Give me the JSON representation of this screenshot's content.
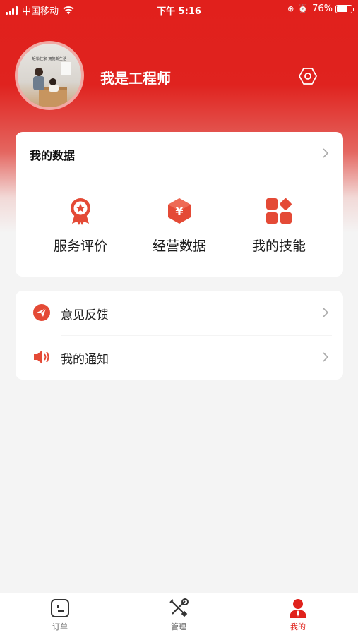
{
  "status_bar": {
    "carrier": "中国移动",
    "time": "下午 5:16",
    "battery": "76%",
    "battery_level": 0.76
  },
  "profile": {
    "name": "我是工程师",
    "avatar_caption": "轻松住家 拥抱新生活"
  },
  "data_card": {
    "title": "我的数据",
    "items": [
      {
        "label": "服务评价",
        "icon": "award-ribbon-icon"
      },
      {
        "label": "经营数据",
        "icon": "yuan-hexagon-icon"
      },
      {
        "label": "我的技能",
        "icon": "app-grid-icon"
      }
    ]
  },
  "menu": {
    "items": [
      {
        "label": "意见反馈",
        "icon": "paper-plane-icon"
      },
      {
        "label": "我的通知",
        "icon": "speaker-icon"
      }
    ]
  },
  "tab_bar": {
    "tabs": [
      {
        "label": "订单",
        "icon": "order-icon",
        "active": false
      },
      {
        "label": "管理",
        "icon": "tools-icon",
        "active": false
      },
      {
        "label": "我的",
        "icon": "person-icon",
        "active": true
      }
    ]
  },
  "colors": {
    "accent": "#e0221c",
    "background": "#f4f4f4"
  }
}
